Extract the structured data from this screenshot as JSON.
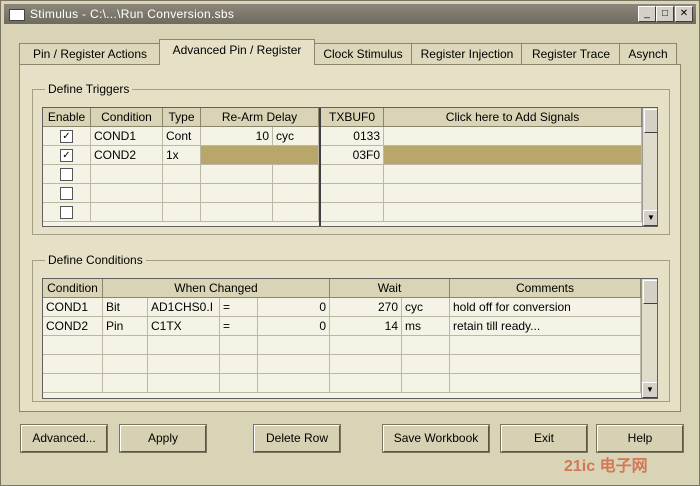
{
  "window": {
    "title": "Stimulus - C:\\...\\Run Conversion.sbs"
  },
  "tabs": [
    "Pin / Register Actions",
    "Advanced Pin / Register",
    "Clock Stimulus",
    "Register Injection",
    "Register Trace",
    "Asynch"
  ],
  "triggers": {
    "group_label": "Define Triggers",
    "headers": {
      "enable": "Enable",
      "condition": "Condition",
      "type": "Type",
      "rearm": "Re-Arm Delay",
      "signal": "TXBUF0",
      "add": "Click here to Add Signals"
    },
    "rows": [
      {
        "enabled": true,
        "condition": "COND1",
        "type": "Cont",
        "delay": "10",
        "unit": "cyc",
        "value": "0133"
      },
      {
        "enabled": true,
        "condition": "COND2",
        "type": "1x",
        "delay": "",
        "unit": "",
        "value": "03F0"
      }
    ]
  },
  "conditions": {
    "group_label": "Define Conditions",
    "headers": {
      "condition": "Condition",
      "when": "When Changed",
      "wait": "Wait",
      "comments": "Comments"
    },
    "rows": [
      {
        "condition": "COND1",
        "kind": "Bit",
        "target": "AD1CHS0.I",
        "op": "=",
        "value": "0",
        "wait": "270",
        "unit": "cyc",
        "comment": "hold off for conversion"
      },
      {
        "condition": "COND2",
        "kind": "Pin",
        "target": "C1TX",
        "op": "=",
        "value": "0",
        "wait": "14",
        "unit": "ms",
        "comment": "retain till ready..."
      }
    ]
  },
  "buttons": {
    "advanced": "Advanced...",
    "apply": "Apply",
    "delete_row": "Delete Row",
    "save_workbook": "Save Workbook",
    "exit": "Exit",
    "help": "Help"
  },
  "watermark": "21ic 电子网"
}
